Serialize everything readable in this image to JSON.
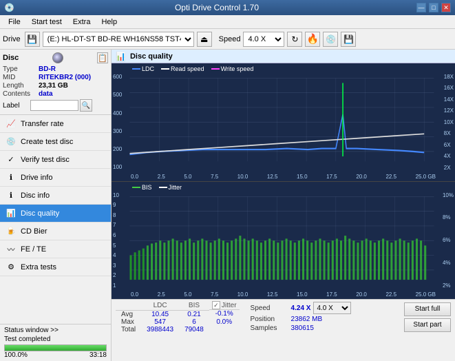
{
  "titlebar": {
    "title": "Opti Drive Control 1.70",
    "controls": [
      "—",
      "□",
      "✕"
    ]
  },
  "menubar": {
    "items": [
      "File",
      "Start test",
      "Extra",
      "Help"
    ]
  },
  "toolbar": {
    "drive_label": "Drive",
    "drive_value": "(E:)  HL-DT-ST BD-RE  WH16NS58 TST4",
    "speed_label": "Speed",
    "speed_value": "4.0 X"
  },
  "disc": {
    "title": "Disc",
    "type_label": "Type",
    "type_value": "BD-R",
    "mid_label": "MID",
    "mid_value": "RITEKBR2 (000)",
    "length_label": "Length",
    "length_value": "23,31 GB",
    "contents_label": "Contents",
    "contents_value": "data",
    "label_label": "Label",
    "label_value": ""
  },
  "nav": {
    "items": [
      {
        "id": "transfer-rate",
        "label": "Transfer rate",
        "active": false
      },
      {
        "id": "create-test-disc",
        "label": "Create test disc",
        "active": false
      },
      {
        "id": "verify-test-disc",
        "label": "Verify test disc",
        "active": false
      },
      {
        "id": "drive-info",
        "label": "Drive info",
        "active": false
      },
      {
        "id": "disc-info",
        "label": "Disc info",
        "active": false
      },
      {
        "id": "disc-quality",
        "label": "Disc quality",
        "active": true
      },
      {
        "id": "cd-bier",
        "label": "CD Bier",
        "active": false
      },
      {
        "id": "fe-te",
        "label": "FE / TE",
        "active": false
      },
      {
        "id": "extra-tests",
        "label": "Extra tests",
        "active": false
      }
    ]
  },
  "disc_quality": {
    "title": "Disc quality",
    "legend": {
      "ldc_label": "LDC",
      "ldc_color": "#4488ff",
      "read_label": "Read speed",
      "read_color": "#ffffff",
      "write_label": "Write speed",
      "write_color": "#ff44ff"
    },
    "legend2": {
      "bis_label": "BIS",
      "bis_color": "#44cc44",
      "jitter_label": "Jitter",
      "jitter_color": "#ffffff"
    }
  },
  "stats": {
    "col_ldc": "LDC",
    "col_bis": "BIS",
    "jitter_checked": true,
    "col_jitter": "Jitter",
    "col_speed": "Speed",
    "speed_value": "4.24 X",
    "speed_color": "#0000cc",
    "speed_select": "4.0 X",
    "avg_label": "Avg",
    "avg_ldc": "10.45",
    "avg_bis": "0.21",
    "avg_jitter": "-0.1%",
    "max_label": "Max",
    "max_ldc": "547",
    "max_bis": "6",
    "max_jitter": "0.0%",
    "total_label": "Total",
    "total_ldc": "3988443",
    "total_bis": "79048",
    "position_label": "Position",
    "position_value": "23862 MB",
    "samples_label": "Samples",
    "samples_value": "380615",
    "start_full_label": "Start full",
    "start_part_label": "Start part"
  },
  "status": {
    "window_btn": "Status window >>",
    "text": "Test completed",
    "progress": 100,
    "progress_text": "100.0%",
    "time": "33:18"
  }
}
